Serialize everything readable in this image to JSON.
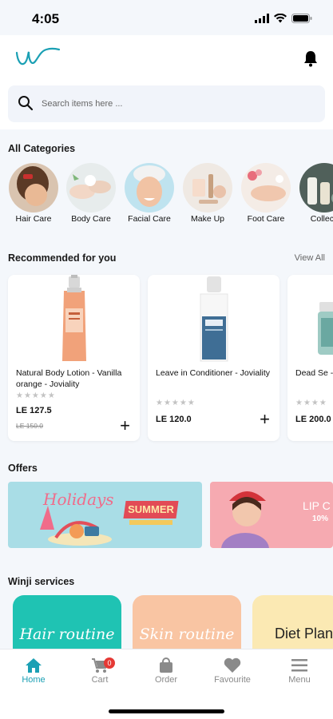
{
  "status": {
    "time": "4:05"
  },
  "search": {
    "placeholder": "Search items here ..."
  },
  "sections": {
    "categories": "All Categories",
    "recommended": "Recommended for you",
    "view_all": "View All",
    "offers": "Offers",
    "services": "Winji services"
  },
  "categories": [
    {
      "label": "Hair Care"
    },
    {
      "label": "Body Care"
    },
    {
      "label": "Facial Care"
    },
    {
      "label": "Make Up"
    },
    {
      "label": "Foot Care"
    },
    {
      "label": "Collecti"
    }
  ],
  "products": [
    {
      "name": "Natural Body Lotion - Vanilla orange  - Joviality",
      "price": "LE 127.5",
      "old_price": "LE 150.0",
      "stars": "★★★★★",
      "add": "+"
    },
    {
      "name": "Leave in Conditioner - Joviality",
      "price": "LE 120.0",
      "old_price": "",
      "stars": "★★★★★",
      "add": "+"
    },
    {
      "name": "Dead Se - Jovial",
      "price": "LE 200.0",
      "old_price": "",
      "stars": "★★★★",
      "add": "+"
    }
  ],
  "offers": [
    {
      "headline": "Holidays",
      "tag": "SUMMER"
    },
    {
      "headline": "LIP C",
      "sub": "10%"
    }
  ],
  "services": [
    {
      "label": "Hair routine",
      "color": "#1fc3b3"
    },
    {
      "label": "Skin routine",
      "color": "#f9c5a3"
    },
    {
      "label": "Diet Plan",
      "color": "#fbe9b3"
    }
  ],
  "tabs": [
    {
      "label": "Home",
      "icon": "home-icon",
      "active": true
    },
    {
      "label": "Cart",
      "icon": "cart-icon",
      "badge": "0"
    },
    {
      "label": "Order",
      "icon": "bag-icon"
    },
    {
      "label": "Favourite",
      "icon": "heart-icon"
    },
    {
      "label": "Menu",
      "icon": "menu-icon"
    }
  ],
  "colors": {
    "accent": "#1ba0b4",
    "background": "#f4f7fb"
  }
}
